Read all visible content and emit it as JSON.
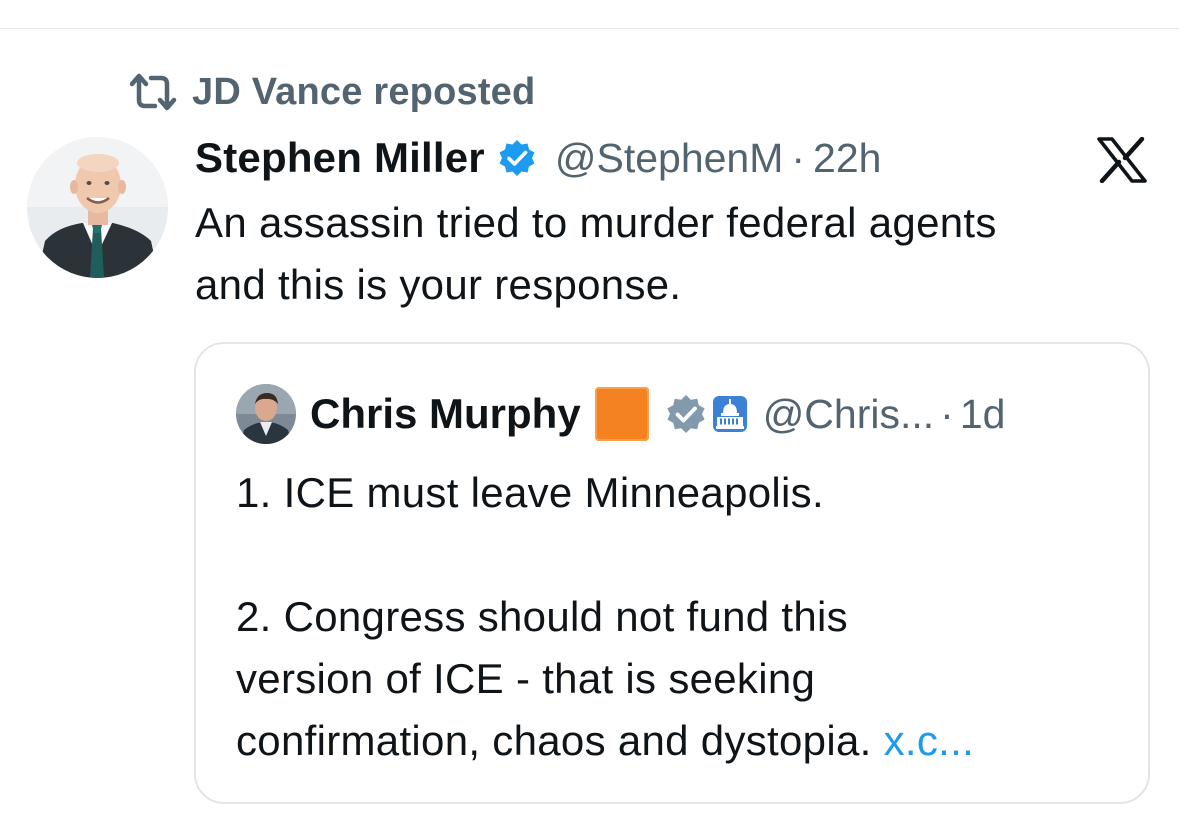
{
  "repost": {
    "label": "JD Vance reposted",
    "icon": "repost-icon"
  },
  "tweet": {
    "author_name": "Stephen Miller",
    "verified": true,
    "handle": "@StephenM",
    "separator": "·",
    "time": "22h",
    "platform_icon": "x-logo-icon",
    "text_line1": "An assassin tried to murder federal agents",
    "text_line2": "and this is your response."
  },
  "quote": {
    "author_name": "Chris Murphy",
    "emoji": "orange-square",
    "verified_type": "government-gray",
    "extra_badge": "capitol-building-icon",
    "handle": "@Chris...",
    "separator": "·",
    "time": "1d",
    "line1": "1. ICE must leave Minneapolis.",
    "line2": "2. Congress should not fund this",
    "line3": "version of ICE - that is seeking",
    "line4_text": "confirmation, chaos and dystopia. ",
    "line4_link": "x.c..."
  },
  "colors": {
    "text_primary": "#0f1419",
    "text_secondary": "#536471",
    "verified_blue": "#1d9bf0",
    "link_blue": "#1d9bf0",
    "orange_square": "#f58220",
    "gray_badge": "#829aab",
    "border": "#e3e6e8"
  }
}
